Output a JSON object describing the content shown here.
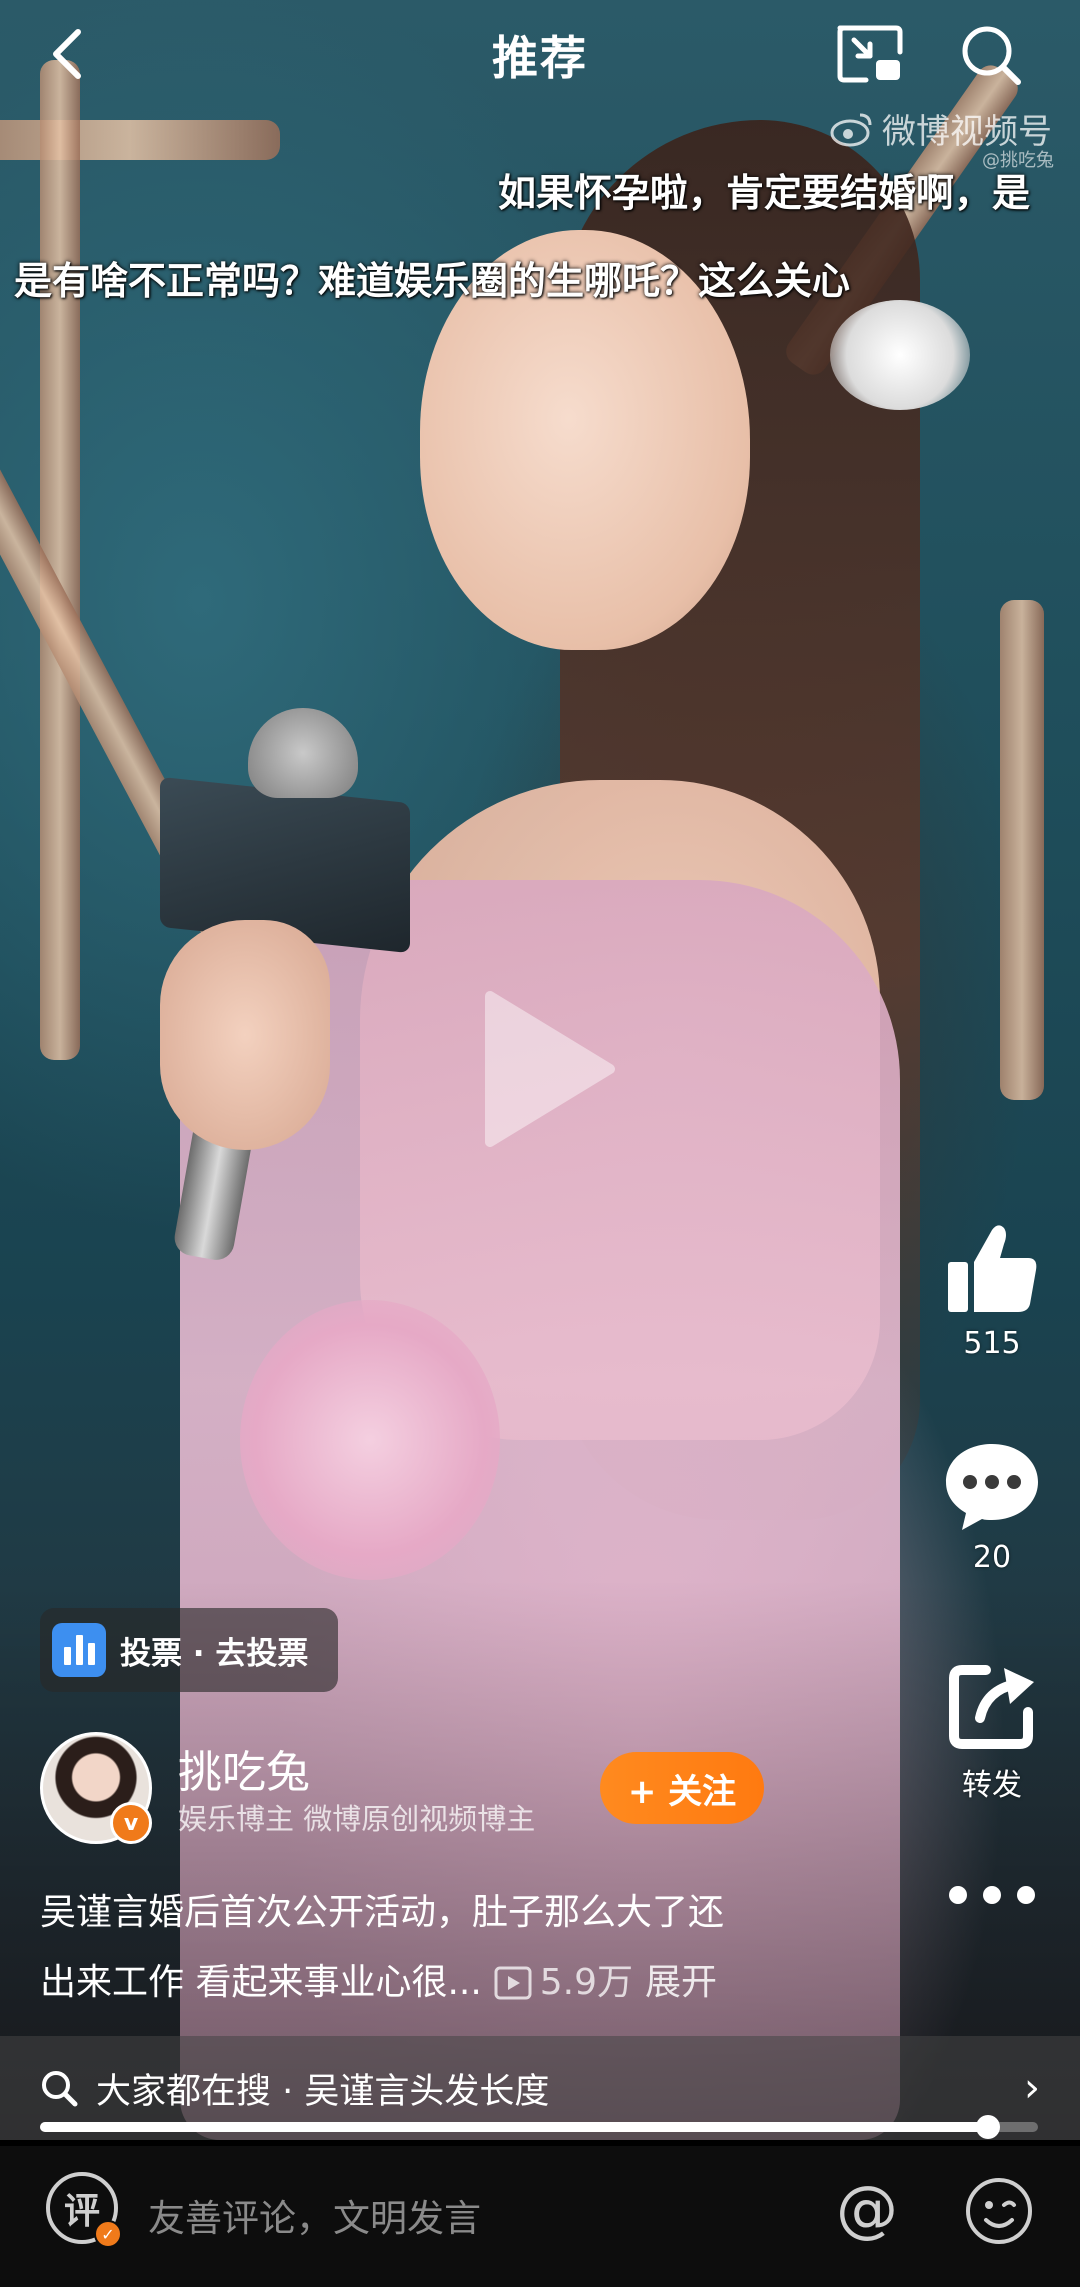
{
  "header": {
    "title": "推荐",
    "watermark": "微博视频号",
    "watermark_sub": "@挑吃兔"
  },
  "danmaku": [
    "如果怀孕啦，肯定要结婚啊，是",
    "是有啥不正常吗？难道娱乐圈的生哪吒？这么关心"
  ],
  "rail": {
    "likes": "515",
    "comments": "20",
    "share_label": "转发"
  },
  "vote": {
    "label": "投票 · 去投票"
  },
  "author": {
    "name": "挑吃兔",
    "tags": "娱乐博主  微博原创视频博主",
    "verified_mark": "v",
    "follow_label": "+ 关注"
  },
  "caption": {
    "line1": "吴谨言婚后首次公开活动，肚子那么大了还",
    "line2": "出来工作 看起来事业心很...",
    "plays": "5.9万",
    "expand": "展开"
  },
  "search_strip": {
    "text": "大家都在搜 · 吴谨言头发长度",
    "arrow": "›"
  },
  "progress": {
    "fraction": 0.95
  },
  "bottom": {
    "comment_glyph": "评",
    "placeholder": "友善评论，文明发言",
    "at_symbol": "@"
  },
  "colors": {
    "accent": "#ff8a1f",
    "vote": "#3d8ff0"
  }
}
